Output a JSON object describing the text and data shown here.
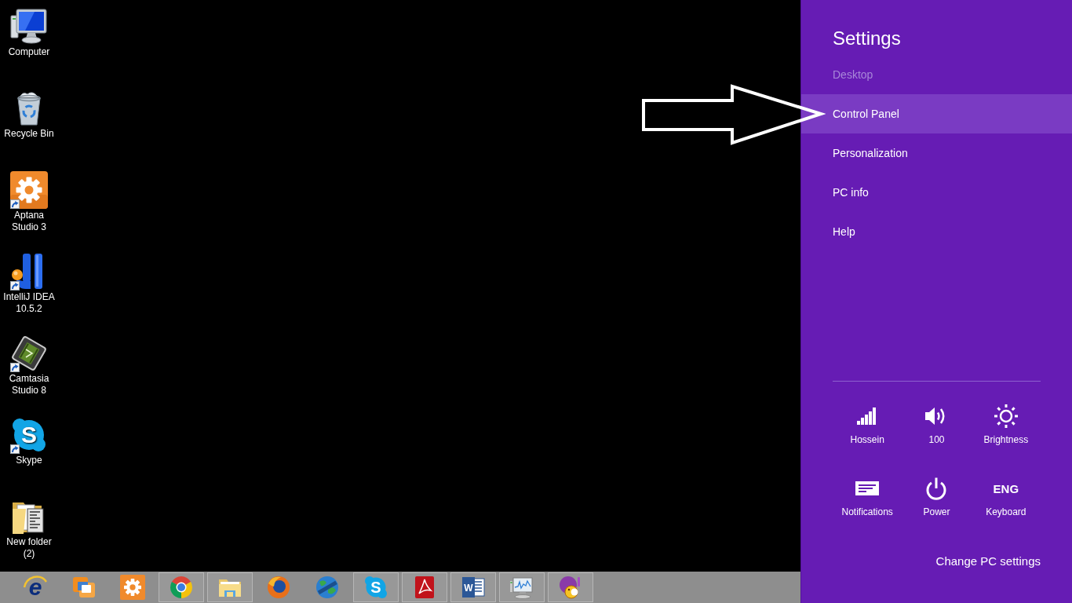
{
  "desktop_icons": [
    {
      "kind": "computer",
      "label": "Computer",
      "shortcut": false
    },
    {
      "kind": "bin",
      "label": "Recycle Bin",
      "shortcut": false
    },
    {
      "kind": "gearapp",
      "label": "Aptana Studio 3",
      "shortcut": true
    },
    {
      "kind": "ide",
      "label": "IntelliJ IDEA 10.5.2",
      "shortcut": true
    },
    {
      "kind": "recorder",
      "label": "Camtasia Studio 8",
      "shortcut": true
    },
    {
      "kind": "messenger",
      "glyph": "S",
      "label": "Skype",
      "shortcut": true
    },
    {
      "kind": "folder",
      "label": "New folder (2)",
      "shortcut": false
    }
  ],
  "taskbar": {
    "items": [
      {
        "kind": "ie",
        "glyph": "e",
        "running": false
      },
      {
        "kind": "vmware",
        "running": false
      },
      {
        "kind": "aptana",
        "running": false
      },
      {
        "kind": "chrome",
        "running": true
      },
      {
        "kind": "explorer",
        "running": true
      },
      {
        "kind": "firefox",
        "running": false
      },
      {
        "kind": "globe",
        "running": false
      },
      {
        "kind": "skype",
        "glyph": "S",
        "running": true
      },
      {
        "kind": "acrobat",
        "running": true
      },
      {
        "kind": "word",
        "glyph": "W",
        "running": true
      },
      {
        "kind": "monitor",
        "running": true
      },
      {
        "kind": "yahoo",
        "running": true
      }
    ]
  },
  "settings_panel": {
    "title": "Settings",
    "context": "Desktop",
    "items": [
      {
        "label": "Control Panel",
        "selected": true
      },
      {
        "label": "Personalization",
        "selected": false
      },
      {
        "label": "PC info",
        "selected": false
      },
      {
        "label": "Help",
        "selected": false
      }
    ],
    "quick_settings": [
      {
        "kind": "network",
        "label": "Hossein"
      },
      {
        "kind": "volume",
        "label": "100"
      },
      {
        "kind": "brightness",
        "label": "Brightness"
      },
      {
        "kind": "notifications",
        "label": "Notifications"
      },
      {
        "kind": "power",
        "label": "Power"
      },
      {
        "kind": "keyboard",
        "glyph": "ENG",
        "label": "Keyboard"
      }
    ],
    "footer_link": "Change PC settings"
  }
}
